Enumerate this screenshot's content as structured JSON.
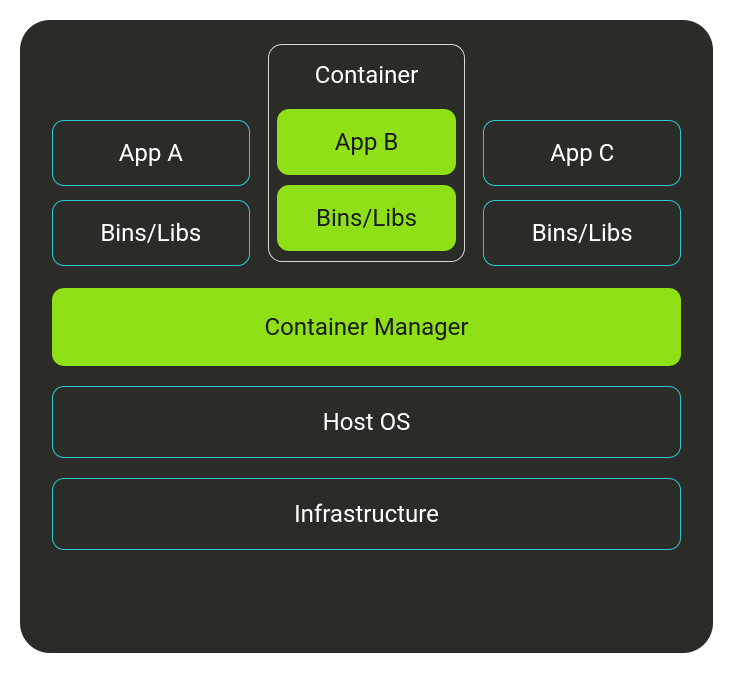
{
  "container_label": "Container",
  "columns": {
    "left": {
      "app": "App A",
      "libs": "Bins/Libs"
    },
    "center": {
      "app": "App B",
      "libs": "Bins/Libs"
    },
    "right": {
      "app": "App C",
      "libs": "Bins/Libs"
    }
  },
  "layers": {
    "container_manager": "Container Manager",
    "host_os": "Host OS",
    "infrastructure": "Infrastructure"
  },
  "colors": {
    "background": "#2b2b28",
    "cyan_border": "#2fc9d0",
    "green_fill": "#8fe016",
    "text_light": "#ffffff",
    "text_dark": "#1a1a1a"
  }
}
